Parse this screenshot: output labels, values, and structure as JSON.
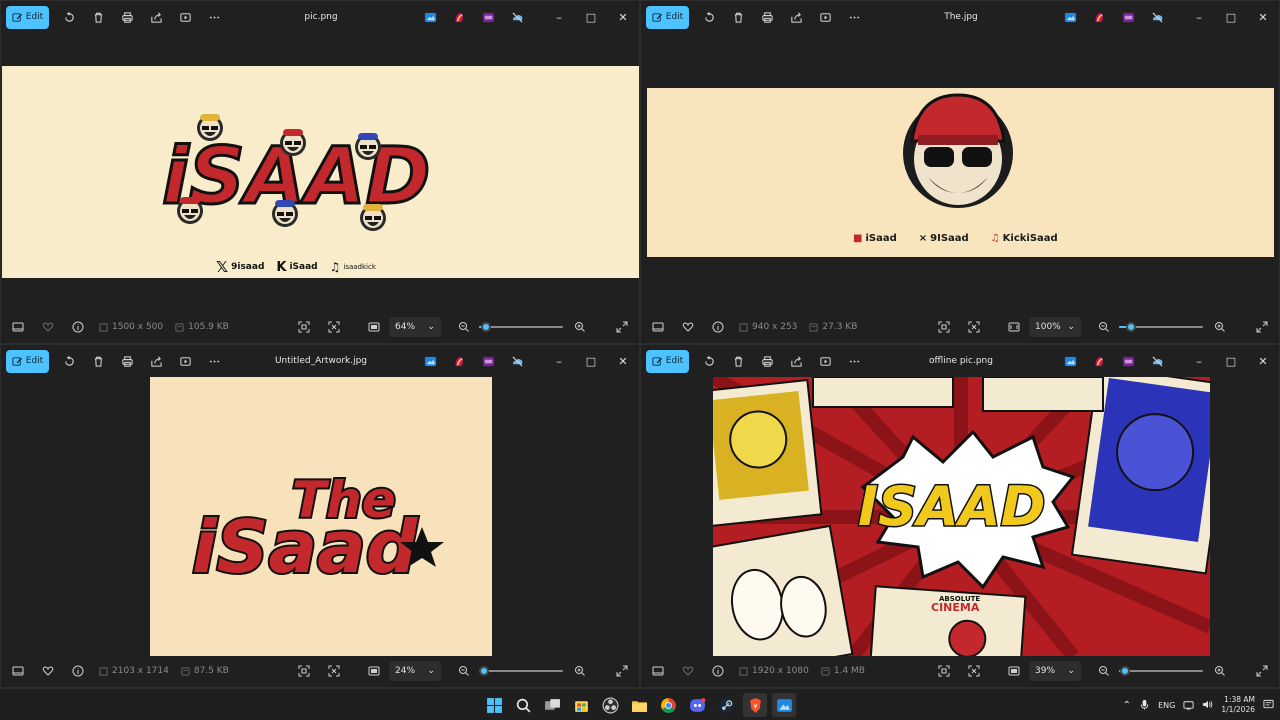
{
  "windows": [
    {
      "filename": "pic.png",
      "edit_label": "Edit",
      "dimensions": "1500 x 500",
      "filesize": "105.9 KB",
      "zoom": "64%",
      "zoom_fraction": 0.08,
      "favorite": false,
      "image": {
        "title": "iSAAD",
        "socials": [
          {
            "icon": "x-logo-icon",
            "handle": "9isaad"
          },
          {
            "icon": "kick-logo-icon",
            "handle": "iSaad"
          },
          {
            "icon": "tiktok-logo-icon",
            "handle": "isaadkick"
          }
        ]
      }
    },
    {
      "filename": "The.jpg",
      "edit_label": "Edit",
      "dimensions": "940 x 253",
      "filesize": "27.3 KB",
      "zoom": "100%",
      "zoom_fraction": 0.14,
      "favorite": false,
      "image": {
        "socials": [
          {
            "icon": "kick-logo-icon",
            "handle": "iSaad"
          },
          {
            "icon": "x-logo-icon",
            "handle": "9ISaad"
          },
          {
            "icon": "tiktok-logo-icon",
            "handle": "KickiSaad"
          }
        ]
      }
    },
    {
      "filename": "Untitled_Artwork.jpg",
      "edit_label": "Edit",
      "dimensions": "2103 x 1714",
      "filesize": "87.5 KB",
      "zoom": "24%",
      "zoom_fraction": 0.03,
      "favorite": false,
      "image": {
        "line1": "The",
        "line2": "iSaad"
      }
    },
    {
      "filename": "offline pic.png",
      "edit_label": "Edit",
      "dimensions": "1920 x 1080",
      "filesize": "1.4 MB",
      "zoom": "39%",
      "zoom_fraction": 0.07,
      "favorite": false,
      "image": {
        "title": "ISAAD",
        "badge_top": "ABSOLUTE",
        "badge_main": "CINEMA"
      }
    }
  ],
  "taskbar": {
    "apps": [
      "windows-start-icon",
      "search-icon",
      "task-view-icon",
      "microsoft-store-icon",
      "obs-icon",
      "file-explorer-icon",
      "chrome-icon",
      "discord-icon",
      "steam-icon",
      "brave-icon",
      "photos-icon"
    ],
    "language": "ENG",
    "time": "1:38 AM",
    "date": "1/1/2026"
  },
  "colors": {
    "accent": "#4cc2ff",
    "window_bg": "#202020",
    "cream": "#f7ecc9",
    "logo_red": "#c3282d"
  }
}
